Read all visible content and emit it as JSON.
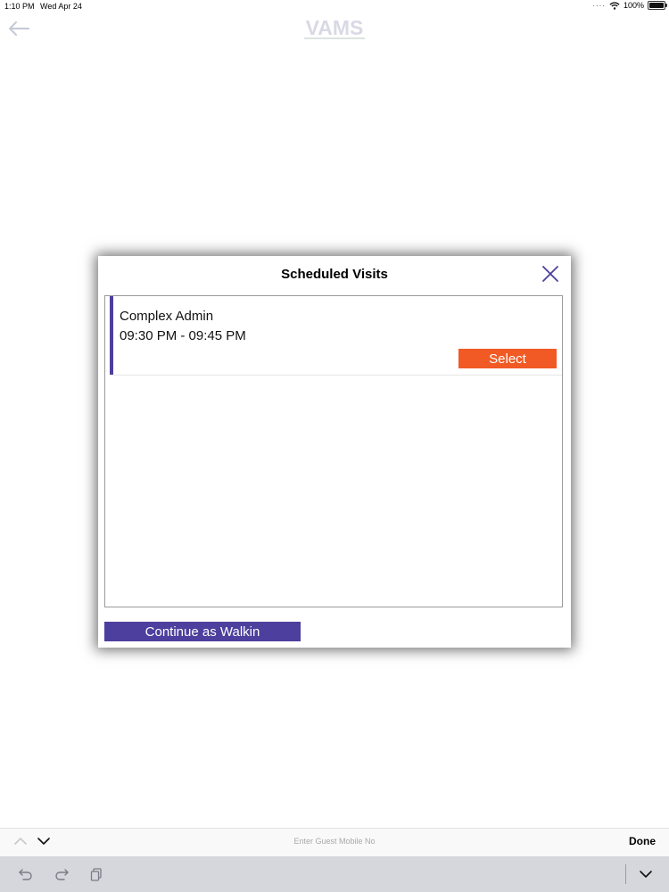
{
  "status_bar": {
    "time": "1:10 PM",
    "date": "Wed Apr 24",
    "battery": "100%",
    "icons": [
      "wifi-icon",
      "battery-icon"
    ]
  },
  "nav": {
    "logo": "VAMS",
    "back_icon": "back-arrow-icon"
  },
  "modal": {
    "title": "Scheduled Visits",
    "close_icon": "close-icon",
    "visits": [
      {
        "name": "Complex Admin",
        "time": "09:30 PM - 09:45 PM",
        "select_label": "Select"
      }
    ],
    "walkin_label": "Continue as Walkin"
  },
  "accessory_bar": {
    "placeholder": "Enter Guest Mobile No",
    "done_label": "Done"
  },
  "keyboard_toolbar": {
    "icons": [
      "undo-icon",
      "redo-icon",
      "paste-icon",
      "hide-keyboard-icon"
    ]
  },
  "colors": {
    "accent": "#4c3f9d",
    "select": "#f15a24",
    "logo": "#d9d9e6"
  }
}
